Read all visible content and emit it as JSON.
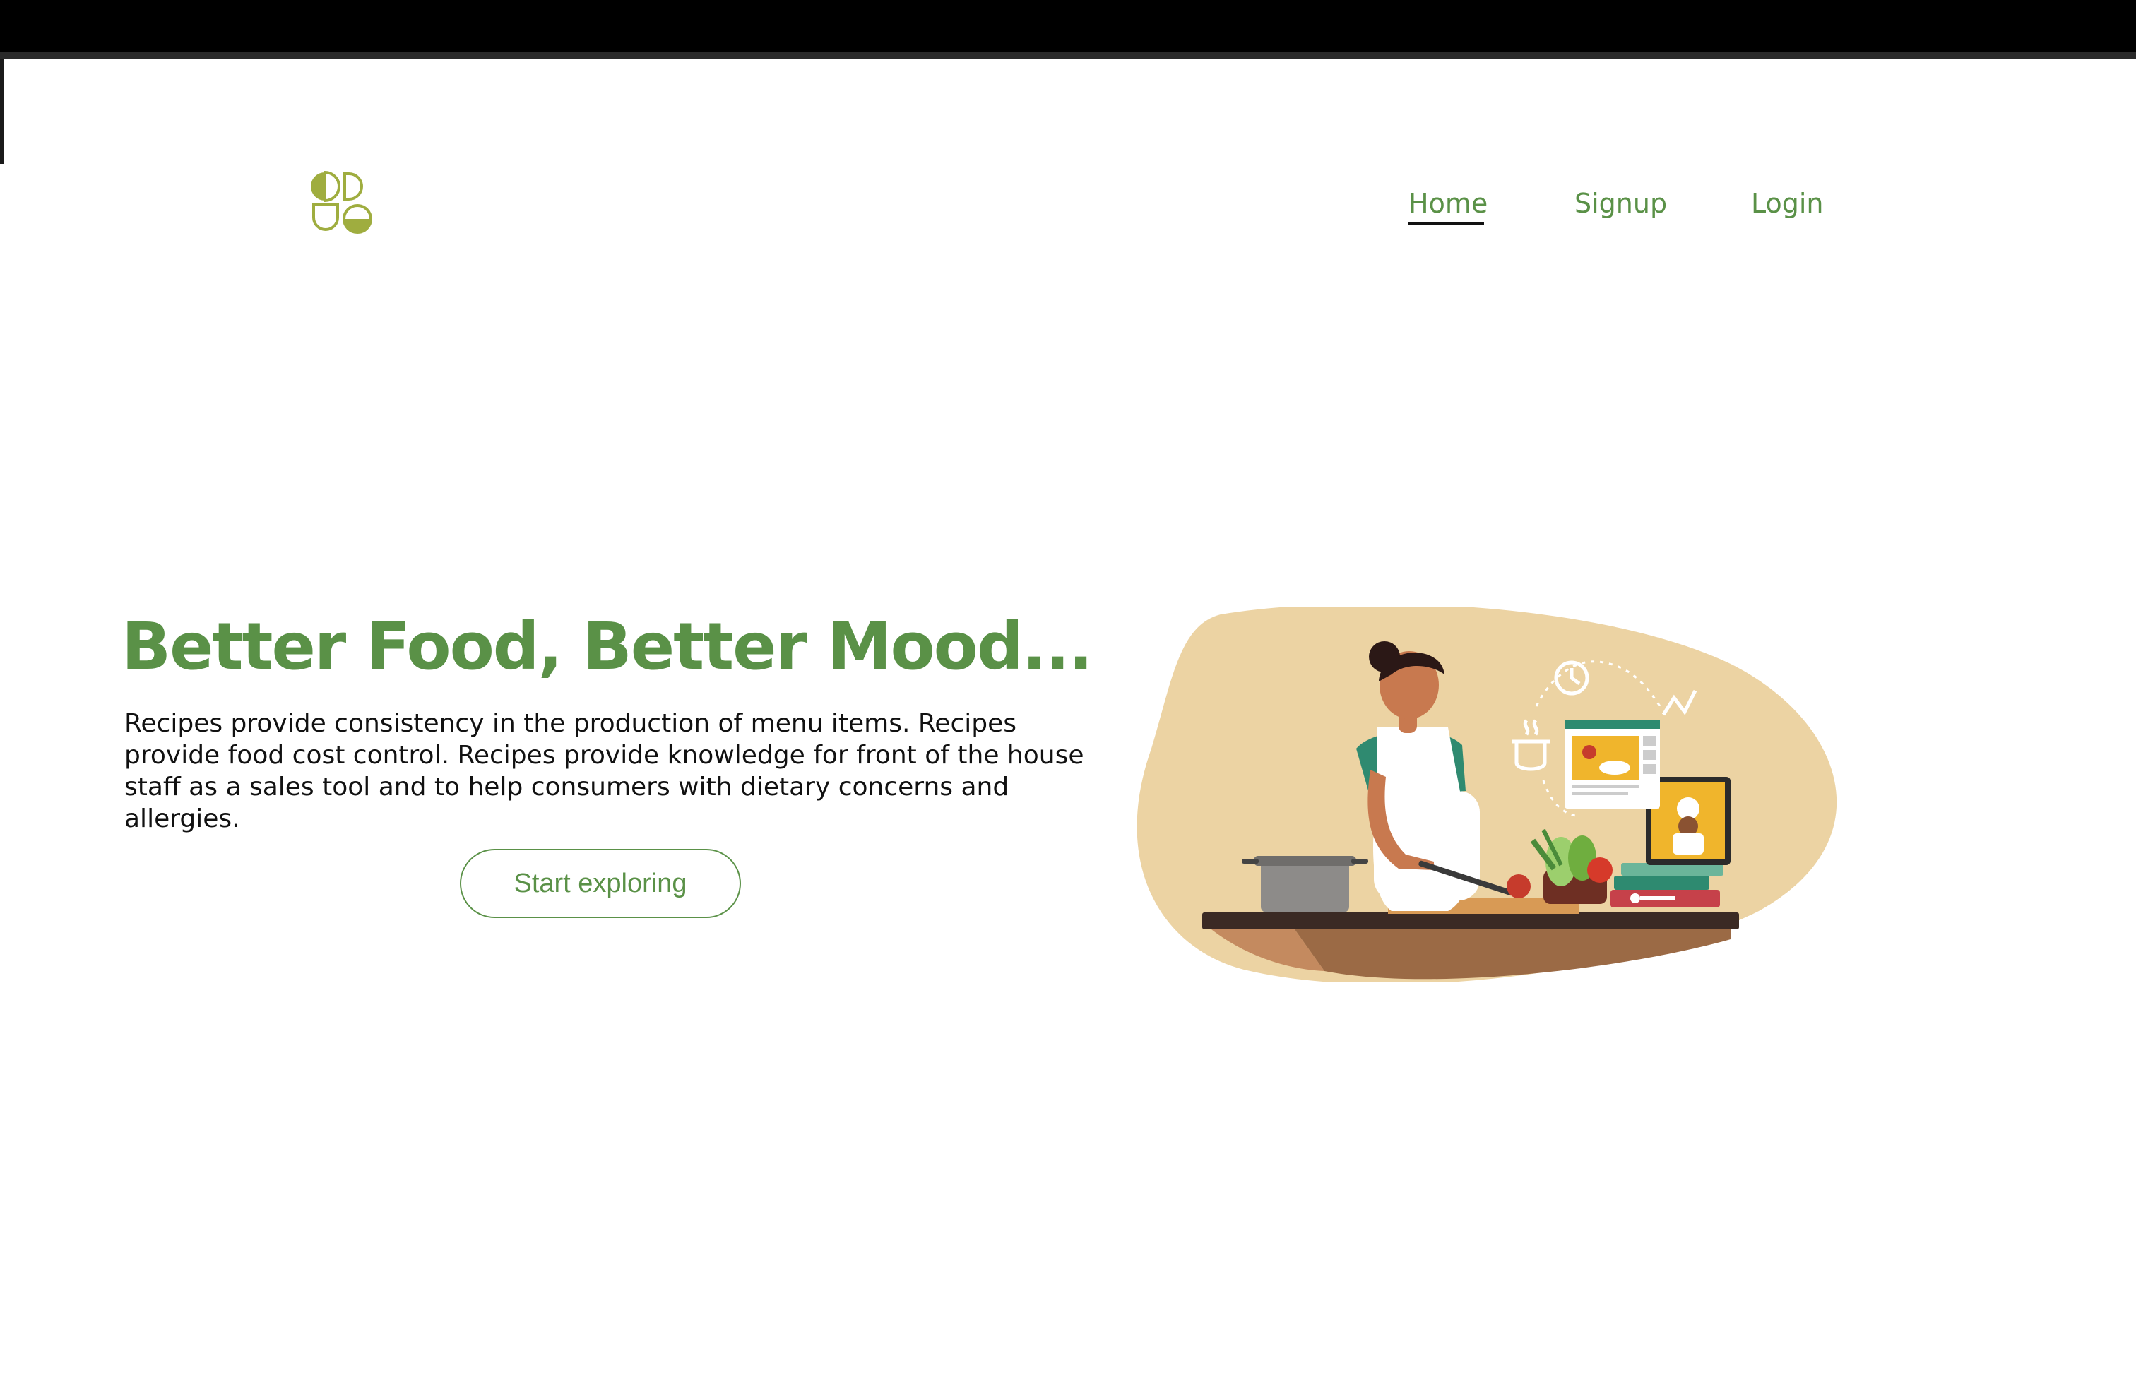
{
  "window": {
    "chrome_color": "#000000"
  },
  "brand": {
    "logo_icon": "clover-logo-icon",
    "accent_color": "#5a9147",
    "logo_color": "#9fad3f"
  },
  "nav": {
    "items": [
      {
        "label": "Home",
        "active": true
      },
      {
        "label": "Signup",
        "active": false
      },
      {
        "label": "Login",
        "active": false
      }
    ]
  },
  "hero": {
    "title": "Better Food, Better Mood...",
    "description": "Recipes provide consistency in the production of menu items. Recipes provide food cost control. Recipes provide knowledge for front of the house staff as a sales tool and to help consumers with dietary concerns and allergies.",
    "cta_label": "Start exploring",
    "illustration": "woman-cooking-illustration",
    "blob_color": "#ecd3a3"
  }
}
